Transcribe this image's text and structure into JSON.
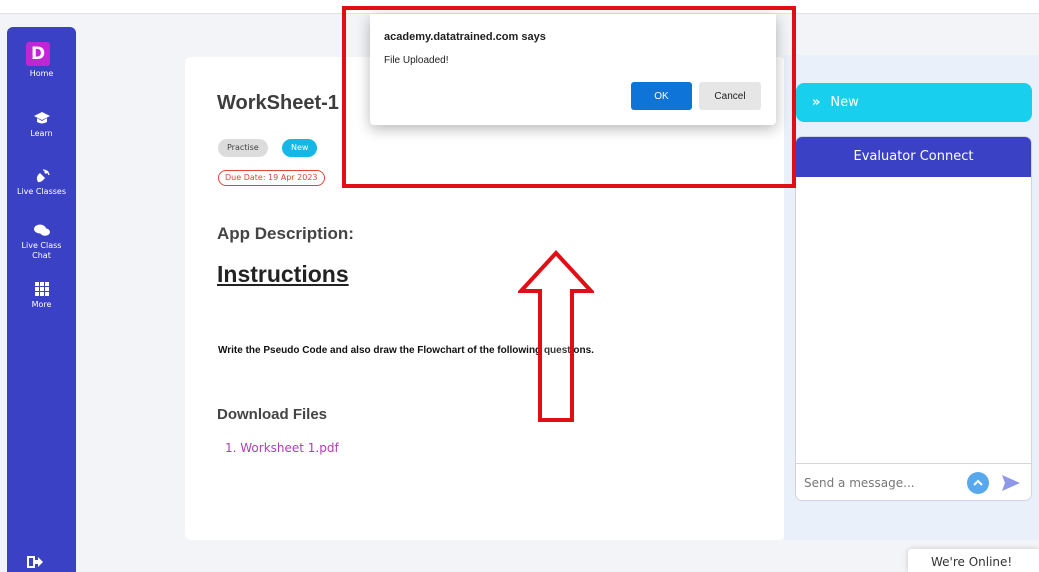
{
  "sidebar": {
    "logo_letter": "D",
    "items": [
      {
        "label": "Home",
        "icon": "home-icon"
      },
      {
        "label": "Learn",
        "icon": "graduation-cap-icon"
      },
      {
        "label": "Live Classes",
        "icon": "satellite-icon"
      },
      {
        "label": "Live Class Chat",
        "icon": "chat-bubbles-icon"
      },
      {
        "label": "More",
        "icon": "grid-icon"
      }
    ],
    "logout_icon": "logout-icon"
  },
  "worksheet": {
    "title": "WorkSheet-1",
    "badges": [
      "Practise",
      "New"
    ],
    "due_date": "Due Date: 19 Apr 2023",
    "app_description_label": "App Description:",
    "instructions_heading": "Instructions",
    "instruction_text": "Write the Pseudo Code and also draw the Flowchart of the following questions.",
    "download_files_label": "Download Files",
    "files": [
      "1. Worksheet 1.pdf"
    ]
  },
  "right_panel": {
    "new_button_chevron": "»",
    "new_button_label": "New",
    "evaluator_header": "Evaluator Connect",
    "message_placeholder": "Send a message..."
  },
  "online_status": "We're Online!",
  "dialog": {
    "title": "academy.datatrained.com says",
    "message": "File Uploaded!",
    "ok_label": "OK",
    "cancel_label": "Cancel"
  },
  "colors": {
    "sidebar": "#3b41c5",
    "accent_cyan": "#18d0ee",
    "link_purple": "#b03db5",
    "due_red": "#e0453a",
    "ok_blue": "#0f74d7",
    "annotation_red": "#e10f15"
  }
}
